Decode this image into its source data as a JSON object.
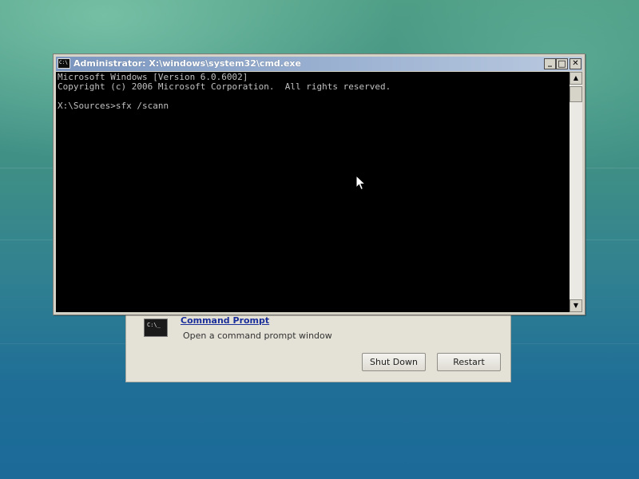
{
  "recovery_dialog": {
    "icon_text": "C:\\_",
    "command_prompt_link": "Command Prompt",
    "command_prompt_desc": "Open a command prompt window",
    "shut_down_label": "Shut Down",
    "restart_label": "Restart"
  },
  "cmd_window": {
    "title": "Administrator: X:\\windows\\system32\\cmd.exe",
    "icon_text": "C:\\",
    "minimize_glyph": "_",
    "maximize_glyph": "□",
    "close_glyph": "✕",
    "scroll_up_glyph": "▲",
    "scroll_down_glyph": "▼",
    "console_lines": [
      "Microsoft Windows [Version 6.0.6002]",
      "Copyright (c) 2006 Microsoft Corporation.  All rights reserved.",
      "",
      "X:\\Sources>sfx /scann"
    ]
  },
  "icons": {
    "cmd_app": "command-prompt-icon",
    "pointer": "mouse-pointer-icon"
  }
}
